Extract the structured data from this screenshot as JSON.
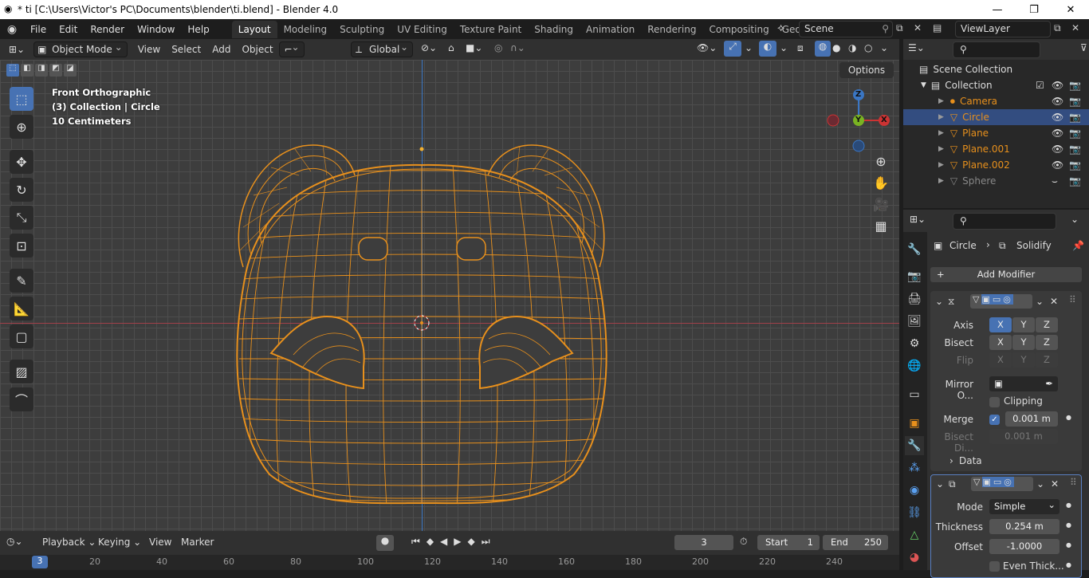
{
  "window": {
    "title": "* ti [C:\\Users\\Victor's PC\\Documents\\blender\\ti.blend] - Blender 4.0"
  },
  "menu": [
    "File",
    "Edit",
    "Render",
    "Window",
    "Help"
  ],
  "workspaces": [
    "Layout",
    "Modeling",
    "Sculpting",
    "UV Editing",
    "Texture Paint",
    "Shading",
    "Animation",
    "Rendering",
    "Compositing",
    "Geomet"
  ],
  "scene": {
    "name": "Scene",
    "viewlayer": "ViewLayer"
  },
  "viewport_header": {
    "mode": "Object Mode",
    "menus": [
      "View",
      "Select",
      "Add",
      "Object"
    ],
    "orientation": "Global",
    "options": "Options"
  },
  "overlay": {
    "view": "Front Orthographic",
    "collection": "(3) Collection | Circle",
    "scale": "10 Centimeters"
  },
  "gizmo": {
    "z": "Z",
    "y": "Y",
    "x": "X"
  },
  "timeline": {
    "menus": [
      "Playback",
      "Keying",
      "View",
      "Marker"
    ],
    "frame": "3",
    "start_label": "Start",
    "start": "1",
    "end_label": "End",
    "end": "250",
    "cursor": "3",
    "ruler": [
      "20",
      "40",
      "60",
      "80",
      "100",
      "120",
      "140",
      "160",
      "180",
      "200",
      "220",
      "240"
    ]
  },
  "outliner": {
    "scene_collection": "Scene Collection",
    "collection": "Collection",
    "items": [
      {
        "name": "Camera"
      },
      {
        "name": "Circle"
      },
      {
        "name": "Plane"
      },
      {
        "name": "Plane.001"
      },
      {
        "name": "Plane.002"
      },
      {
        "name": "Sphere"
      }
    ]
  },
  "properties": {
    "object": "Circle",
    "modifier": "Solidify",
    "add_modifier": "Add Modifier",
    "mirror": {
      "axis_label": "Axis",
      "bisect_label": "Bisect",
      "flip_label": "Flip",
      "mirror_obj_label": "Mirror O...",
      "clipping": "Clipping",
      "merge_label": "Merge",
      "merge": "0.001 m",
      "bisect_dist_label": "Bisect Di...",
      "bisect_dist": "0.001 m",
      "data": "Data",
      "x": "X",
      "y": "Y",
      "z": "Z"
    },
    "solidify": {
      "mode_label": "Mode",
      "mode": "Simple",
      "thickness_label": "Thickness",
      "thickness": "0.254 m",
      "offset_label": "Offset",
      "offset": "-1.0000",
      "even": "Even Thick..."
    }
  }
}
